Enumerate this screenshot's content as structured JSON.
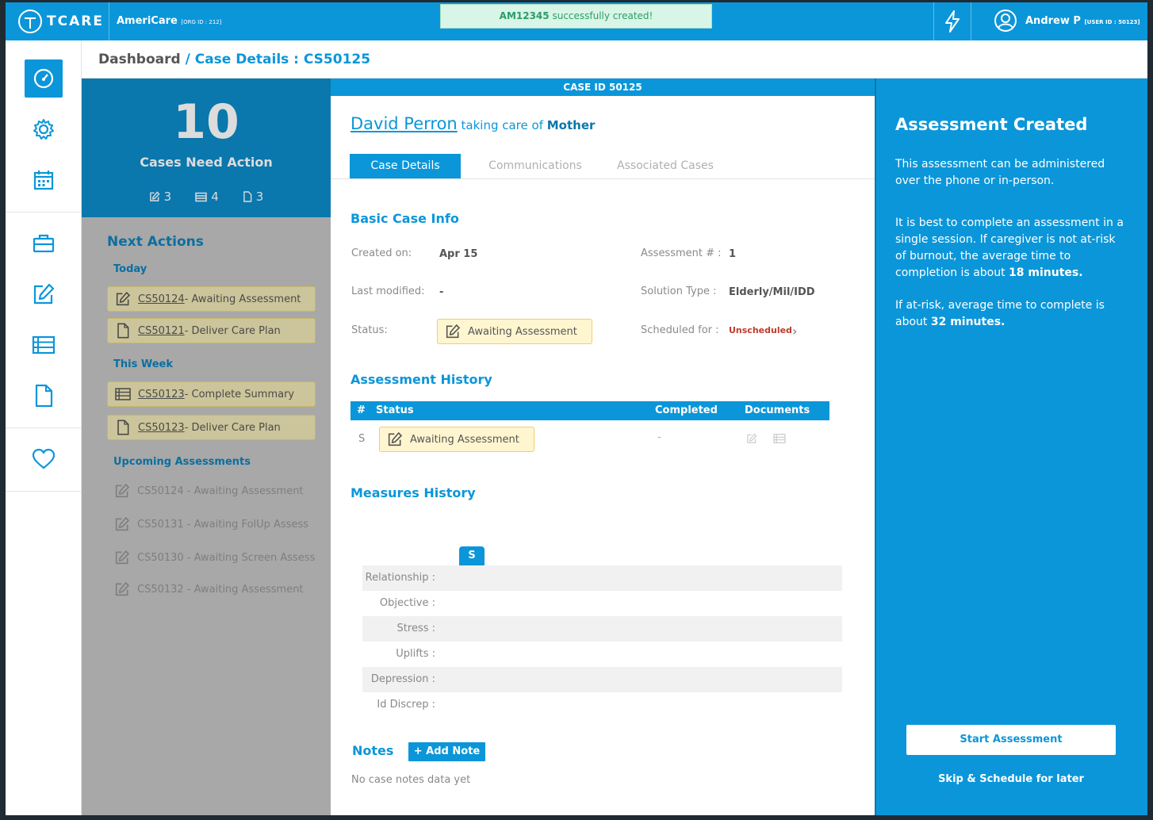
{
  "app": {
    "logo_text": "TCARE",
    "org_name": "AmeriCare",
    "org_id": "[ORG ID : 212]"
  },
  "toast": {
    "id": "AM12345",
    "message": " successfully created!"
  },
  "user": {
    "name": "Andrew P",
    "user_id": "[USER ID : 50123]"
  },
  "breadcrumb": {
    "root": "Dashboard",
    "current": " / Case Details : CS50125"
  },
  "nav_icons": [
    "dashboard-icon",
    "settings-icon",
    "calendar-icon",
    "briefcase-icon",
    "edit-icon",
    "list-icon",
    "document-icon",
    "heart-icon"
  ],
  "stats": {
    "count": "10",
    "label": "Cases Need Action",
    "edit_count": "3",
    "list_count": "4",
    "doc_count": "3"
  },
  "next_actions": {
    "title": "Next Actions",
    "today_label": "Today",
    "today": [
      {
        "id": "CS50124",
        "text": " - Awaiting Assessment",
        "icon": "edit-icon"
      },
      {
        "id": "CS50121",
        "text": " - Deliver Care Plan",
        "icon": "document-icon"
      }
    ],
    "week_label": "This Week",
    "week": [
      {
        "id": "CS50123",
        "text": " - Complete Summary",
        "icon": "list-icon"
      },
      {
        "id": "CS50123",
        "text": " - Deliver Care Plan",
        "icon": "document-icon"
      }
    ],
    "upcoming_label": "Upcoming Assessments",
    "upcoming": [
      "CS50124 - Awaiting Assessment",
      "CS50131 - Awaiting FolUp Assess",
      "CS50130 - Awaiting Screen Assess",
      "CS50132 - Awaiting Assessment"
    ]
  },
  "case": {
    "bar_label": "CASE ID 50125",
    "person_name": "David Perron",
    "relation_text": " taking care of ",
    "relation": "Mother",
    "tabs": [
      "Case Details",
      "Communications",
      "Associated Cases"
    ],
    "basic_title": "Basic Case Info",
    "created_label": "Created on:",
    "created_value": "Apr 15",
    "assessment_label": "Assessment # :",
    "assessment_value": "1",
    "modified_label": "Last modified:",
    "modified_value": "-",
    "solution_label": "Solution Type :",
    "solution_value": "Elderly/Mil/IDD",
    "status_label": "Status:",
    "status_value": "Awaiting Assessment",
    "scheduled_label": "Scheduled for :",
    "scheduled_value": "Unscheduled",
    "history_title": "Assessment History",
    "history_cols": [
      "#",
      "Status",
      "Completed",
      "Documents"
    ],
    "history_row": {
      "num": "S",
      "status": "Awaiting Assessment",
      "completed": "-"
    },
    "measures_title": "Measures History",
    "measures_tag": "S",
    "measures": [
      "Relationship :",
      "Objective :",
      "Stress :",
      "Uplifts :",
      "Depression :",
      "Id Discrep :"
    ],
    "notes_title": "Notes",
    "add_note": "+ Add Note",
    "no_notes": "No case notes data yet"
  },
  "right_panel": {
    "title": "Assessment Created",
    "p1": "This assessment can be administered over the phone or in-person.",
    "p2_a": "It is best to complete an assessment in a single session. If caregiver is not at-risk of burnout, the average time to completion is about ",
    "p2_b": "18 minutes.",
    "p3_a": "If at-risk, average time to complete is about ",
    "p3_b": "32 minutes.",
    "start_button": "Start Assessment",
    "skip_link": "Skip & Schedule for later"
  },
  "colors": {
    "primary": "#0b96d9",
    "primary_dark": "#0a77ad",
    "toast_bg": "#d9f5e8",
    "warn_chip": "#fff6d0",
    "danger": "#c0392b"
  }
}
